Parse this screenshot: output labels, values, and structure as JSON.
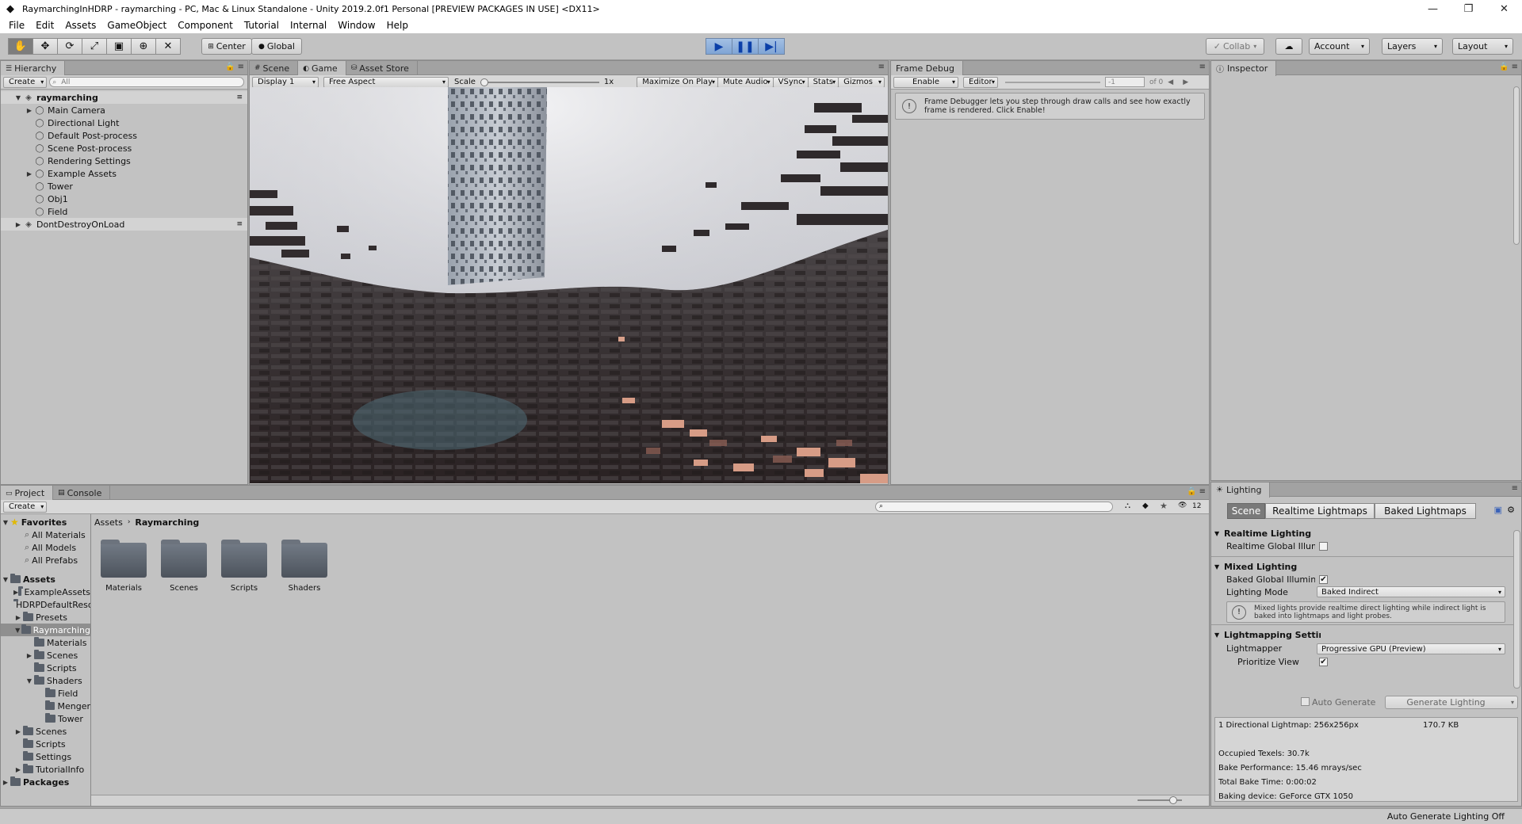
{
  "window": {
    "title": "RaymarchingInHDRP - raymarching - PC, Mac & Linux Standalone - Unity 2019.2.0f1 Personal [PREVIEW PACKAGES IN USE] <DX11>",
    "controls": [
      "—",
      "❐",
      "✕"
    ]
  },
  "menu": [
    "File",
    "Edit",
    "Assets",
    "GameObject",
    "Component",
    "Tutorial",
    "Internal",
    "Window",
    "Help"
  ],
  "toolbar": {
    "pivot": "Center",
    "space": "Global",
    "collab": "Collab",
    "account": "Account",
    "layers": "Layers",
    "layout": "Layout"
  },
  "hierarchy": {
    "tab": "Hierarchy",
    "create": "Create",
    "search_placeholder": "All",
    "scene": "raymarching",
    "items": [
      "Main Camera",
      "Directional Light",
      "Default Post-process",
      "Scene Post-process",
      "Rendering Settings",
      "Example Assets",
      "Tower",
      "Obj1",
      "Field"
    ],
    "ddol": "DontDestroyOnLoad"
  },
  "viewtabs": [
    "Scene",
    "Game",
    "Asset Store"
  ],
  "game": {
    "display": "Display 1",
    "aspect": "Free Aspect",
    "scale_label": "Scale",
    "scale_value": "1x",
    "buttons": [
      "Maximize On Play",
      "Mute Audio",
      "VSync",
      "Stats",
      "Gizmos"
    ]
  },
  "frame_debug": {
    "tab": "Frame Debug",
    "enable": "Enable",
    "editor": "Editor",
    "index": "-1",
    "of": "of 0",
    "message": "Frame Debugger lets you step through draw calls and see how exactly frame is rendered. Click Enable!"
  },
  "inspector": {
    "tab": "Inspector"
  },
  "project": {
    "tabs": [
      "Project",
      "Console"
    ],
    "create": "Create",
    "count": "12",
    "breadcrumb": [
      "Assets",
      "Raymarching"
    ],
    "favorites": "Favorites",
    "fav_items": [
      "All Materials",
      "All Models",
      "All Prefabs"
    ],
    "assets": "Assets",
    "asset_items": [
      "ExampleAssets",
      "HDRPDefaultResources",
      "Presets",
      "Raymarching"
    ],
    "ray_children": [
      "Materials",
      "Scenes",
      "Scripts",
      "Shaders"
    ],
    "shader_children": [
      "Field",
      "Menger",
      "Tower"
    ],
    "asset_items_after": [
      "Scenes",
      "Scripts",
      "Settings",
      "TutorialInfo"
    ],
    "packages": "Packages",
    "folders": [
      "Materials",
      "Scenes",
      "Scripts",
      "Shaders"
    ]
  },
  "lighting": {
    "tab": "Lighting",
    "subtabs": [
      "Scene",
      "Realtime Lightmaps",
      "Baked Lightmaps"
    ],
    "realtime_header": "Realtime Lighting",
    "realtime_gi": "Realtime Global Illumination",
    "mixed_header": "Mixed Lighting",
    "baked_gi": "Baked Global Illumination",
    "lighting_mode_label": "Lighting Mode",
    "lighting_mode": "Baked Indirect",
    "mixed_info": "Mixed lights provide realtime direct lighting while indirect light is baked into lightmaps and light probes.",
    "lightmapping_header": "Lightmapping Settings",
    "lightmapper_label": "Lightmapper",
    "lightmapper": "Progressive GPU (Preview)",
    "prioritize_label": "Prioritize View",
    "auto_generate": "Auto Generate",
    "generate": "Generate Lighting",
    "stats": {
      "lightmap": "1 Directional Lightmap: 256x256px",
      "size": "170.7 KB",
      "texels": "Occupied Texels: 30.7k",
      "perf": "Bake Performance: 15.46 mrays/sec",
      "time": "Total Bake Time: 0:00:02",
      "device": "Baking device: GeForce GTX 1050"
    }
  },
  "status": "Auto Generate Lighting Off"
}
